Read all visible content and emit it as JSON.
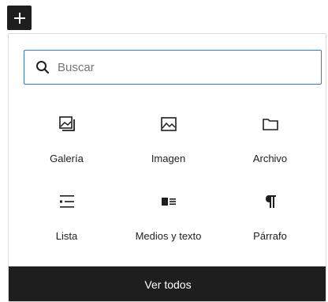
{
  "toggle": {
    "icon": "plus-icon"
  },
  "search": {
    "placeholder": "Buscar",
    "value": "",
    "icon": "search-icon"
  },
  "blocks": [
    {
      "label": "Galería",
      "icon": "gallery-icon"
    },
    {
      "label": "Imagen",
      "icon": "image-icon"
    },
    {
      "label": "Archivo",
      "icon": "folder-icon"
    },
    {
      "label": "Lista",
      "icon": "list-icon"
    },
    {
      "label": "Medios y texto",
      "icon": "media-text-icon"
    },
    {
      "label": "Párrafo",
      "icon": "paragraph-icon"
    }
  ],
  "footer": {
    "label": "Ver todos"
  },
  "colors": {
    "accent": "#3a78c2",
    "dark": "#1e1e1e"
  }
}
